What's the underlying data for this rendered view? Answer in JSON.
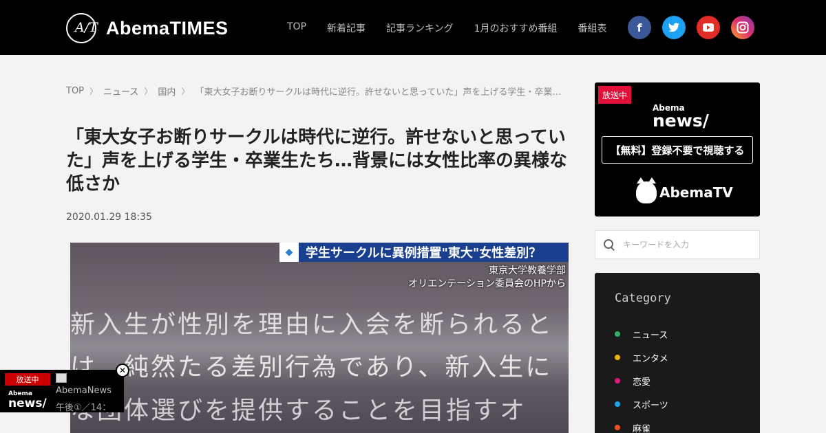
{
  "header": {
    "logo_mark": "A/T",
    "logo_text": "AbemaTIMES",
    "nav": [
      {
        "label": "TOP"
      },
      {
        "label": "新着記事"
      },
      {
        "label": "記事ランキング"
      },
      {
        "label": "1月のおすすめ番組"
      },
      {
        "label": "番組表"
      }
    ],
    "social": [
      {
        "icon": "facebook-icon",
        "glyph": "f",
        "color": "#3b5998"
      },
      {
        "icon": "twitter-icon",
        "glyph": "🐦",
        "color": "#1da1f2"
      },
      {
        "icon": "youtube-icon",
        "glyph": "▶",
        "color": "#e52d27"
      },
      {
        "icon": "instagram-icon",
        "glyph": "◎",
        "color": "#e1306c"
      }
    ]
  },
  "breadcrumb": {
    "items": [
      "TOP",
      "ニュース",
      "国内"
    ],
    "current": "「東大女子お断りサークルは時代に逆行。許せないと思っていた」声を上げる学生・卒業生たち…"
  },
  "article": {
    "title": "「東大女子お断りサークルは時代に逆行。許せないと思っていた」声を上げる学生・卒業生たち…背景には女性比率の異様な低さか",
    "date": "2020.01.29 18:35",
    "image": {
      "banner": "学生サークルに異例措置\"東大\"女性差別？",
      "source_line1": "東京大学教養学部",
      "source_line2": "オリエンテーション委員会のHPから",
      "text_line1": "新入生が性別を理由に入会を断られると",
      "text_line2": "は、純然たる差別行為であり、新入生に",
      "text_line3": "な団体選びを提供することを目指すオ"
    }
  },
  "mini_player": {
    "badge": "放送中",
    "logo_small": "Abema",
    "logo_big": "news/",
    "title": "AbemaNews",
    "time": "午後①／14：",
    "close": "✕"
  },
  "sidebar": {
    "promo": {
      "badge": "放送中",
      "news_small": "Abema",
      "news_big": "news/",
      "button": "【無料】登録不要で視聴する",
      "tv_text": "AbemaTV"
    },
    "search": {
      "placeholder": "キーワードを入力"
    },
    "category": {
      "title": "Category",
      "items": [
        {
          "label": "ニュース",
          "color": "#2fb36b"
        },
        {
          "label": "エンタメ",
          "color": "#e8b400"
        },
        {
          "label": "恋愛",
          "color": "#e0177a"
        },
        {
          "label": "スポーツ",
          "color": "#1aa7e8"
        },
        {
          "label": "麻雀",
          "color": "#f04e23"
        }
      ]
    }
  }
}
